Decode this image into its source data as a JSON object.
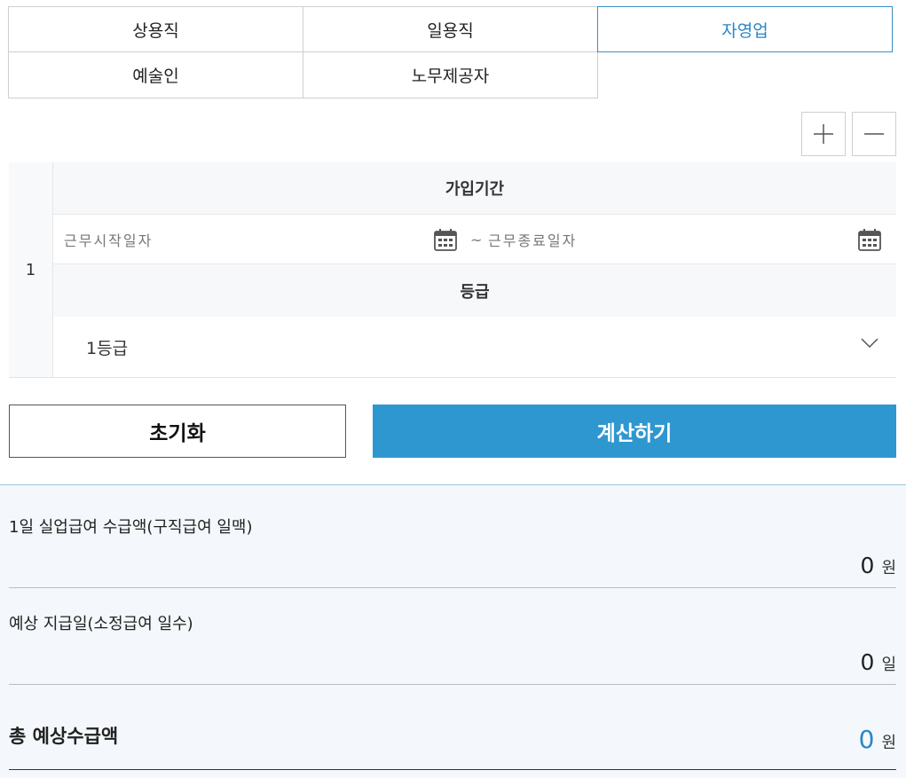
{
  "tabs": [
    {
      "label": "상용직",
      "active": false
    },
    {
      "label": "일용직",
      "active": false
    },
    {
      "label": "자영업",
      "active": true
    },
    {
      "label": "예술인",
      "active": false
    },
    {
      "label": "노무제공자",
      "active": false
    }
  ],
  "controls": {
    "add_icon": "plus-icon",
    "remove_icon": "minus-icon"
  },
  "period_row": {
    "index": "1",
    "period_header": "가입기간",
    "start_placeholder": "근무시작일자",
    "separator": "~",
    "end_placeholder": "근무종료일자",
    "grade_header": "등급",
    "grade_value": "1등급"
  },
  "buttons": {
    "reset": "초기화",
    "calculate": "계산하기"
  },
  "results": {
    "daily_label": "1일 실업급여 수급액(구직급여 일맥)",
    "daily_value": "0",
    "daily_unit": "원",
    "days_label": "예상 지급일(소정급여 일수)",
    "days_value": "0",
    "days_unit": "일",
    "total_label": "총 예상수급액",
    "total_value": "0",
    "total_unit": "원"
  },
  "colors": {
    "accent": "#2f97d0",
    "active_tab": "#2b87c6",
    "results_bg": "#f4f8fc"
  }
}
